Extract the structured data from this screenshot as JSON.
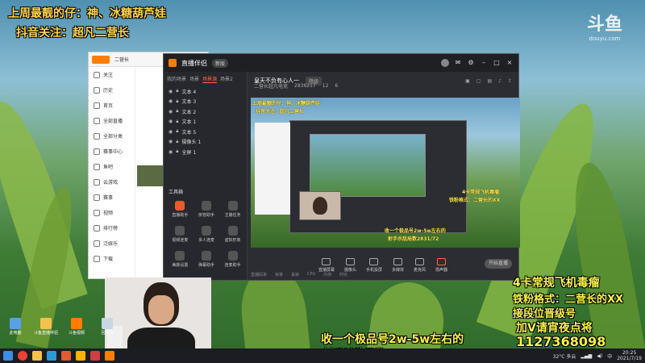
{
  "overlay": {
    "top_line1": "上周最靓的仔：神、冰糖葫芦娃",
    "top_line2": "抖音关注：超凡二营长",
    "right_lines": [
      "4卡常规飞机毒瘤",
      "铁粉格式：二营长的XX",
      "接段位晋级号",
      "加V请宵夜点将",
      "1127368098"
    ],
    "bottom_line1": "收一个极品号2w-5w左右的",
    "bottom_line2": "射手杀敌局数2831/72"
  },
  "watermark": {
    "logo": "斗鱼",
    "sub": "douyu.com"
  },
  "douyu_window": {
    "header_tabs": [
      "关注",
      "二营长"
    ],
    "nav": [
      "关注",
      "历史",
      "首页",
      "全部直播",
      "全部分类",
      "赛事中心",
      "鱼吧",
      "云游戏",
      "赛事",
      "视频",
      "排行榜",
      "泛娱乐",
      "下载"
    ]
  },
  "app": {
    "title": "直播伴侣",
    "version_badge": "新版",
    "tabs": [
      "我的场景",
      "场景",
      "场景源",
      "场景2"
    ],
    "sources": [
      "文本 4",
      "文本 3",
      "文本 2",
      "文本 1",
      "文本 5",
      "摄像头 1",
      "全屏 1"
    ],
    "tools_title": "工具箱",
    "tools": [
      "直播助手",
      "房管助手",
      "主播任务",
      "视频连麦",
      "多人连麦",
      "虚拟形象",
      "美颜设置",
      "弹幕助手",
      "连麦助手"
    ],
    "room_title": "皇天不负有心人一",
    "room_tag": "降级",
    "room_meta": [
      "二营长超凡电竞",
      "2836217",
      "12",
      "6"
    ],
    "bottom_tools": [
      "直播屏幕",
      "摄像头",
      "手机投屏",
      "多媒体",
      "麦克风",
      "扬声器"
    ],
    "go_live": "开始直播",
    "stats": [
      "直播码率",
      "帧率",
      "丢帧",
      "CPU",
      "内存",
      "时长"
    ]
  },
  "preview_text": {
    "left_a": "上周最靓的仔：神、冰糖葫芦娃",
    "left_b": "抖音关注：超凡二营长",
    "right_a": "4卡常规飞机毒瘤",
    "right_b": "铁粉格式：二营长的XX",
    "bottom_a": "收一个极品号2w-5w左右的",
    "bottom_b": "射手杀敌局数2831/72"
  },
  "desktop_icons": [
    "此电脑",
    "斗鱼直播伴侣",
    "斗鱼视频",
    "回收站"
  ],
  "taskbar": {
    "weather": "32°C 多云",
    "time": "20:25",
    "date": "2021/7/19",
    "lang": "中"
  }
}
